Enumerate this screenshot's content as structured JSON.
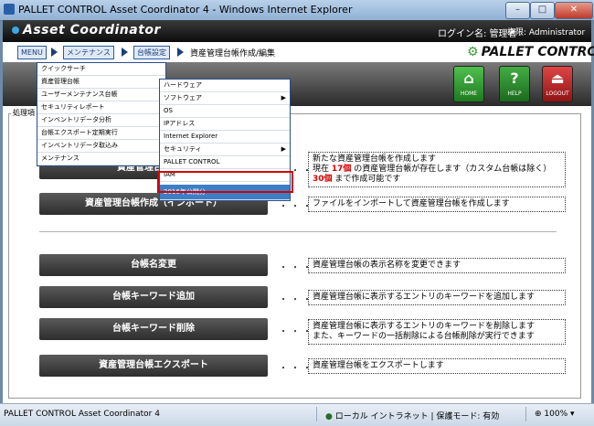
{
  "window": {
    "title": "PALLET CONTROL Asset Coordinator 4 - Windows Internet Explorer",
    "minimize": "–",
    "maximize": "□",
    "close": "✕"
  },
  "header": {
    "logo": "Asset Coordinator",
    "login_label": "ログイン名: 管理者",
    "account_label": "権限: Administrator"
  },
  "breadcrumb": {
    "menu": "MENU",
    "maintenance": "メンテナンス",
    "ledger_settings": "台帳設定",
    "current": "資産管理台帳作成/編集",
    "brand": "PALLET CONTROL"
  },
  "toolbar": {
    "home": "HOME",
    "help": "HELP",
    "logout": "LOGOUT",
    "home_color": "#2e9e2e",
    "help_color": "#2a7a2a",
    "logout_color": "#b82020"
  },
  "panel": {
    "label": "処理項"
  },
  "actions": [
    {
      "label": "資産管理台帳作成",
      "lines": [
        "新たな資産管理台帳を作成します",
        "現在 17個 の資産管理台帳が存在します（カスタム台帳は除く）",
        "30個 まで作成可能です"
      ]
    },
    {
      "label": "資産管理台帳作成（インポート）",
      "lines": [
        "ファイルをインポートして資産管理台帳を作成します"
      ]
    },
    {
      "label": "台帳名変更",
      "lines": [
        "資産管理台帳の表示名称を変更できます"
      ]
    },
    {
      "label": "台帳キーワード追加",
      "lines": [
        "資産管理台帳に表示するエントリのキーワードを追加します"
      ]
    },
    {
      "label": "台帳キーワード削除",
      "lines": [
        "資産管理台帳に表示するエントリのキーワードを削除します",
        "また、キーワードの一括削除による台帳削除が実行できます"
      ]
    },
    {
      "label": "資産管理台帳エクスポート",
      "lines": [
        "資産管理台帳をエクスポートします"
      ]
    }
  ],
  "desc1": {
    "l1": "新たな資産管理台帳を作成します",
    "l2a": "現在 ",
    "l2count": "17個",
    "l2b": " の資産管理台帳が存在します（カスタム台帳は除く）",
    "l3count": "30個",
    "l3b": " まで作成可能です"
  },
  "dots": "・・・",
  "main_menu": [
    "クイックサーチ",
    "資産管理台帳",
    "ユーザーメンテナンス台帳",
    "セキュリティレポート",
    "インベントリデータ分析",
    "台帳エクスポート定期実行",
    "インベントリデータ取込み",
    "メンテナンス"
  ],
  "sub_menu": [
    "ハードウェア",
    "ソフトウェア",
    "OS",
    "IPアドレス",
    "Internet Explorer",
    "セキュリティ",
    "PALLET CONTROL",
    "IAM",
    "2016年公開分"
  ],
  "submenu_arrow": "▶",
  "status": {
    "left": "PALLET CONTROL Asset Coordinator 4",
    "zone": "ローカル イントラネット | 保護モード: 有効",
    "zoom": "100%"
  }
}
